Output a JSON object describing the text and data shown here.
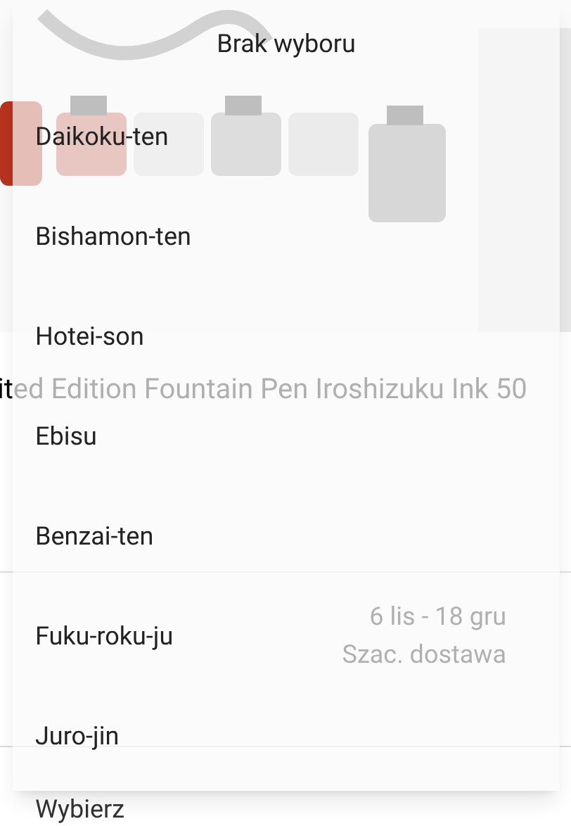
{
  "page": {
    "product_title": "ited Edition Fountain Pen Iroshizuku Ink 50",
    "delivery_date": "6 lis - 18 gru",
    "delivery_label": "Szac. dostawa",
    "select_label": "Wybierz"
  },
  "dialog": {
    "title": "Brak wyboru",
    "options": [
      {
        "label": "Daikoku-ten",
        "selected": false
      },
      {
        "label": "Bishamon-ten",
        "selected": false
      },
      {
        "label": "Hotei-son",
        "selected": false
      },
      {
        "label": "Ebisu",
        "selected": false
      },
      {
        "label": "Benzai-ten",
        "selected": false
      },
      {
        "label": "Fuku-roku-ju",
        "selected": false
      },
      {
        "label": "Juro-jin",
        "selected": false
      }
    ]
  }
}
